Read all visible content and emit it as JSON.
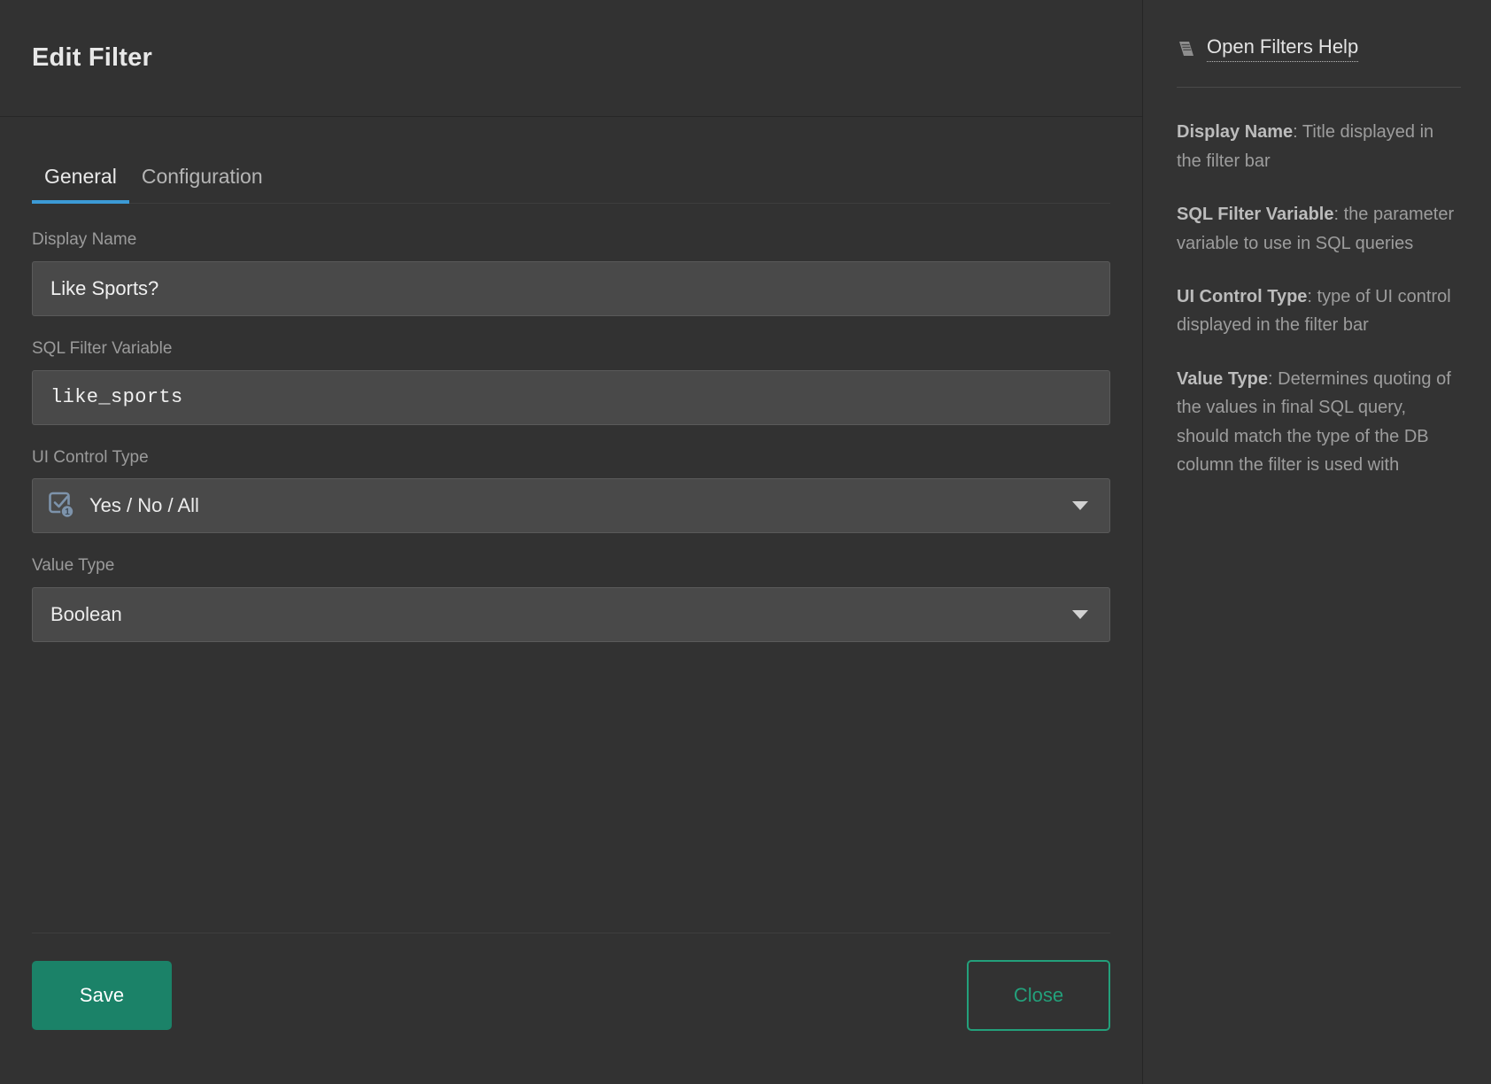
{
  "dialog": {
    "title": "Edit Filter"
  },
  "tabs": [
    {
      "label": "General",
      "active": true
    },
    {
      "label": "Configuration",
      "active": false
    }
  ],
  "form": {
    "display_name": {
      "label": "Display Name",
      "value": "Like Sports?",
      "placeholder": ""
    },
    "sql_filter_variable": {
      "label": "SQL Filter Variable",
      "value": "like_sports",
      "placeholder": ""
    },
    "ui_control_type": {
      "label": "UI Control Type",
      "value": "Yes / No / All",
      "icon": "checkbox-single-select-icon",
      "icon_badge": "1",
      "caret": "chevron-down-icon"
    },
    "value_type": {
      "label": "Value Type",
      "value": "Boolean",
      "caret": "chevron-down-icon"
    }
  },
  "footer": {
    "save_label": "Save",
    "close_label": "Close"
  },
  "help": {
    "link_label": "Open Filters Help",
    "link_icon": "book-icon",
    "items": [
      {
        "term": "Display Name",
        "text": ": Title displayed in the filter bar"
      },
      {
        "term": "SQL Filter Variable",
        "text": ": the parameter variable to use in SQL queries"
      },
      {
        "term": "UI Control Type",
        "text": ": type of UI control displayed in the filter bar"
      },
      {
        "term": "Value Type",
        "text": ": Determines quoting of the values in final SQL query, should match the type of the DB column the filter is used with"
      }
    ]
  },
  "colors": {
    "accent_tab": "#3c9ad6",
    "save_green": "#1b8268",
    "close_green": "#23a07b",
    "panel_bg": "#323232",
    "input_bg": "#494949",
    "icon_blue": "#7d93ab"
  }
}
